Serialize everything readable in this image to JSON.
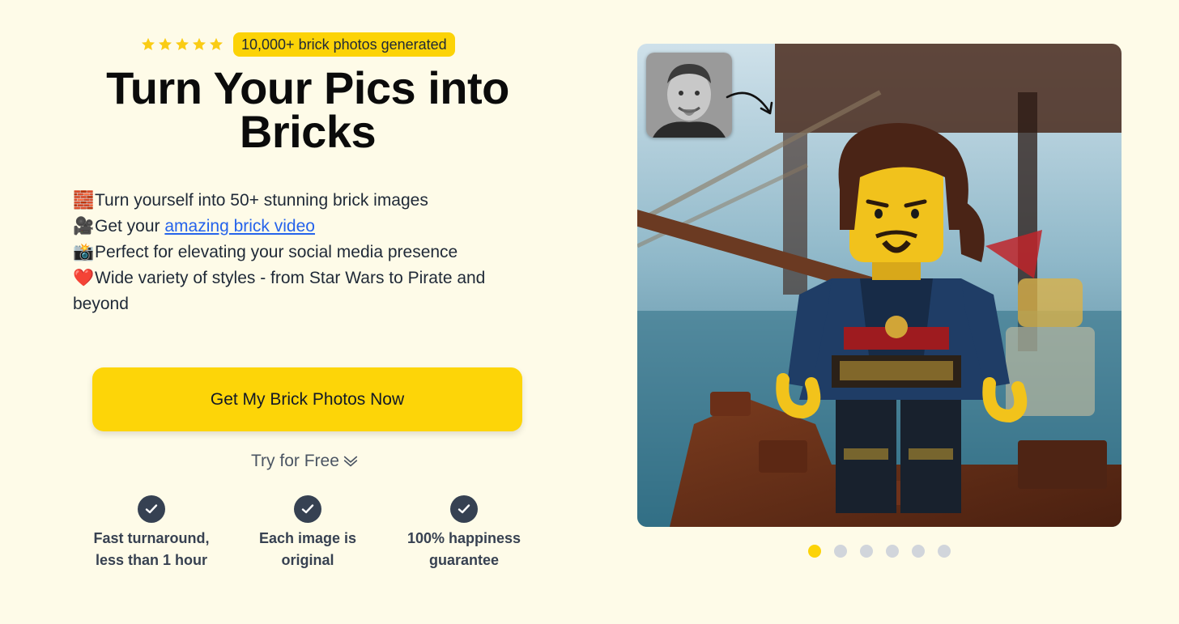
{
  "hero": {
    "rating_stars": 5,
    "badge": "10,000+ brick photos generated",
    "headline_line1": "Turn Your Pics into",
    "headline_line2": "Bricks"
  },
  "features": [
    {
      "icon": "brick-icon",
      "emoji": "🧱",
      "text": "Turn yourself into 50+ stunning brick images"
    },
    {
      "icon": "video-camera-icon",
      "emoji": "🎥",
      "prefix": "Get your ",
      "link": "amazing brick video"
    },
    {
      "icon": "camera-flash-icon",
      "emoji": "📸",
      "text": "Perfect for elevating your social media presence"
    },
    {
      "icon": "heart-icon",
      "emoji": "❤️",
      "text": "Wide variety of styles - from Star Wars to Pirate and beyond"
    }
  ],
  "cta": {
    "label": "Get My Brick Photos Now"
  },
  "try_free": {
    "label": "Try for Free"
  },
  "guarantees": [
    {
      "line1": "Fast turnaround,",
      "line2": "less than 1 hour"
    },
    {
      "line1": "Each image is",
      "line2": "original"
    },
    {
      "line1": "100% happiness",
      "line2": "guarantee"
    }
  ],
  "carousel": {
    "slide_count": 6,
    "active_index": 0
  },
  "colors": {
    "background": "#fefbe8",
    "accent": "#fcd307",
    "link": "#2563eb",
    "check": "#364152"
  }
}
